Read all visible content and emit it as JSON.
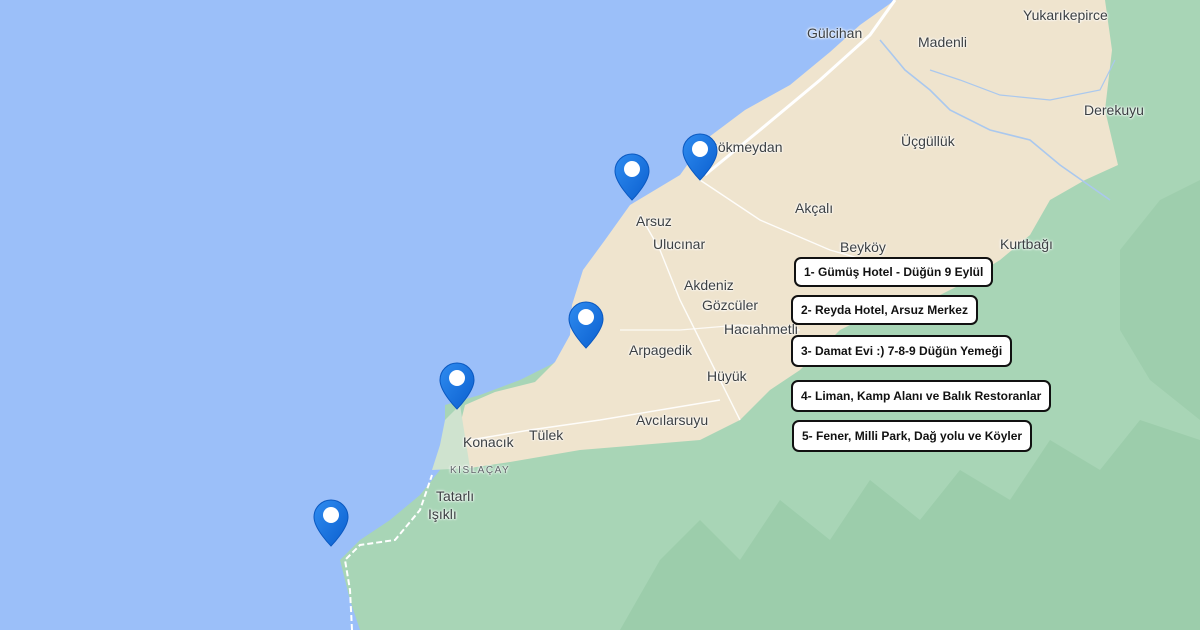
{
  "colors": {
    "sea": "#9bbff9",
    "land": "#efe4ce",
    "forest": "#a8d5b6",
    "forest_dark": "#8fc5a0",
    "road": "#ffffff",
    "border": "#ffffff",
    "river": "#aac8ee",
    "pin": "#1a73e8",
    "pin_dot": "#ffffff",
    "label_text": "#3c4043",
    "legend_border": "#111111"
  },
  "places": [
    {
      "id": "gulcihan",
      "name": "Gülcihan"
    },
    {
      "id": "madenli",
      "name": "Madenli"
    },
    {
      "id": "yukarikepirce",
      "name": "Yukarıkepirce"
    },
    {
      "id": "derekuyu",
      "name": "Derekuyu"
    },
    {
      "id": "gokmeydan",
      "name": "Gökmeydan"
    },
    {
      "id": "ucgulluk",
      "name": "Üçgüllük"
    },
    {
      "id": "akcali",
      "name": "Akçalı"
    },
    {
      "id": "arsuz",
      "name": "Arsuz"
    },
    {
      "id": "ulucinar",
      "name": "Ulucınar"
    },
    {
      "id": "beykoy",
      "name": "Beyköy"
    },
    {
      "id": "kurtbagi",
      "name": "Kurtbağı"
    },
    {
      "id": "akdeniz",
      "name": "Akdeniz"
    },
    {
      "id": "gozculer",
      "name": "Gözcüler"
    },
    {
      "id": "haciahmetli",
      "name": "Hacıahmetli"
    },
    {
      "id": "arpagedik",
      "name": "Arpagedik"
    },
    {
      "id": "huyuk",
      "name": "Hüyük"
    },
    {
      "id": "konacik",
      "name": "Konacık"
    },
    {
      "id": "tulek",
      "name": "Tülek"
    },
    {
      "id": "avcilarsuyu",
      "name": "Avcılarsuyu"
    },
    {
      "id": "kislacay",
      "name": "KISLAÇAY"
    },
    {
      "id": "tatarli",
      "name": "Tatarlı"
    },
    {
      "id": "isikli",
      "name": "Işıklı"
    }
  ],
  "markers": [
    {
      "id": "marker-1",
      "icon": "location-pin-icon"
    },
    {
      "id": "marker-2",
      "icon": "location-pin-icon"
    },
    {
      "id": "marker-3",
      "icon": "location-pin-icon"
    },
    {
      "id": "marker-4",
      "icon": "location-pin-icon"
    },
    {
      "id": "marker-5",
      "icon": "location-pin-icon"
    }
  ],
  "legend": [
    {
      "label": "1- Gümüş Hotel - Düğün 9 Eylül"
    },
    {
      "label": "2- Reyda Hotel, Arsuz Merkez"
    },
    {
      "label": "3- Damat Evi :) 7-8-9 Düğün Yemeği"
    },
    {
      "label": "4- Liman, Kamp Alanı ve Balık Restoranlar"
    },
    {
      "label": "5- Fener, Milli Park, Dağ yolu ve Köyler"
    }
  ]
}
